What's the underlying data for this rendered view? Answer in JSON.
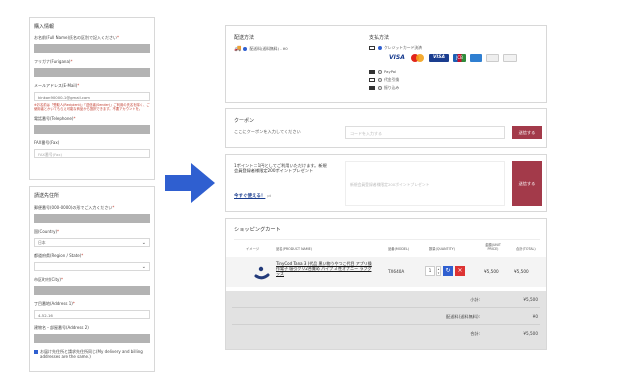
{
  "left_top": {
    "title": "購入情報",
    "name_label": "お名前(Full Name)氏名の区別で記入ください",
    "furigana_label": "フリガナ(Furigana)",
    "email_label": "メールアドレス(E-Mail)",
    "email_value": "kinkon90000-1@gmail.com",
    "email_note": "※お名前は「受取人(Recipient)」「送信者(Sender)」ご利用の氏名を除く、ご使用者とかいてもらえ可能な商品から選択できます。不要アカウントを。",
    "phone_label": "電話番号(Telephone)",
    "fax_label": "FAX番号(Fax)",
    "fax_placeholder": "FAX番号(Fax)"
  },
  "left_bottom": {
    "title": "請送先住所",
    "postal_label": "郵便番号(000-0000)の形でご入力ください",
    "country_label": "国(Country)",
    "country_value": "日本",
    "region_label": "都道府県(Region / State)",
    "city_label": "市区町村(City)",
    "address1_label": "丁目番地(Address 1)",
    "address1_value": "4-52-16",
    "address2_label": "建物名・部屋番号(Address 2)",
    "same_address_label": "お届け先住所と請求先住所同じ(My delivery and billing addresses are the same.)"
  },
  "shipping": {
    "title": "配送方法",
    "option": "配送料(送料無料) - ¥0"
  },
  "payment": {
    "title": "支払方法",
    "options": [
      "クレジットカード決済",
      "PayPal",
      "代金引換",
      "振り込み"
    ]
  },
  "coupon": {
    "title": "クーポン",
    "prompt": "ここにクーポンを入力してください",
    "placeholder": "コードを入力する",
    "button": "送信する"
  },
  "points": {
    "text": "1ポイント＝1円としてご利用いただけます。新規会員登録者様限定200ポイントプレゼント",
    "link": "今すぐ使える！",
    "link_suffix": "pt",
    "placeholder": "新規会員登録者様限定200ポイントプレゼント",
    "button": "送信する"
  },
  "cart": {
    "title": "ショッピングカート",
    "headers": [
      "イメージ",
      "品名(PRODUCT NAME)",
      "品番(MODEL)",
      "数量(QUANTITY)",
      "金額(UNIT PRICE)",
      "合計(TOTAL)"
    ],
    "item": {
      "name": "TinyCod Tana 3 (代品 黒い物うやつこ代目 アプリ操作電子 吸引クリ2合貫め パイプ 3 性オナニー ラブグッズ",
      "model": "TX640A",
      "qty": "1",
      "unit_price": "¥5,500",
      "total": "¥5,500"
    },
    "subtotal_label": "小計:",
    "subtotal": "¥5,500",
    "shipping_label": "配送料(送料無料):",
    "shipping": "¥0",
    "total_label": "合計:",
    "total": "¥5,500"
  },
  "colors": {
    "accent": "#a33a4a",
    "arrow": "#2f5fd0",
    "input_gray": "#b3b3b3"
  }
}
